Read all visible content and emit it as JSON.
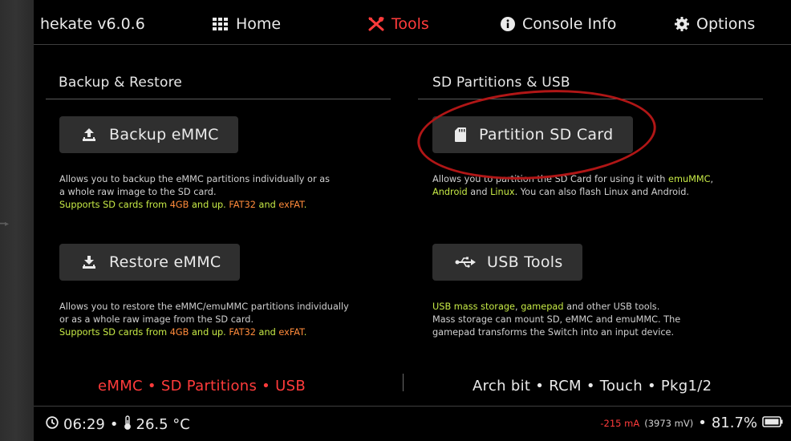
{
  "navbar": {
    "title": "hekate v6.0.6",
    "items": [
      {
        "label": "Home",
        "icon": "grid-icon",
        "active": false
      },
      {
        "label": "Tools",
        "icon": "tools-icon",
        "active": true
      },
      {
        "label": "Console Info",
        "icon": "info-icon",
        "active": false
      },
      {
        "label": "Options",
        "icon": "gear-icon",
        "active": false
      }
    ]
  },
  "backup_restore": {
    "title": "Backup & Restore",
    "backup_button": {
      "label": "Backup eMMC",
      "icon": "upload-icon"
    },
    "backup_desc": {
      "line1": "Allows you to backup the eMMC partitions individually or as",
      "line2": "a whole raw image to the SD card.",
      "line3_a": "Supports SD cards from ",
      "line3_b": "4GB",
      "line3_c": " and up. ",
      "line3_d": "FAT32",
      "line3_e": " and ",
      "line3_f": "exFAT",
      "line3_g": "."
    },
    "restore_button": {
      "label": "Restore eMMC",
      "icon": "download-icon"
    },
    "restore_desc": {
      "line1": "Allows you to restore the eMMC/emuMMC partitions individually",
      "line2": "or as a whole raw image from the SD card.",
      "line3_a": "Supports SD cards from ",
      "line3_b": "4GB",
      "line3_c": " and up. ",
      "line3_d": "FAT32",
      "line3_e": " and ",
      "line3_f": "exFAT",
      "line3_g": "."
    }
  },
  "sd_usb": {
    "title": "SD Partitions & USB",
    "partition_button": {
      "label": "Partition SD Card",
      "icon": "sd-card-icon"
    },
    "partition_desc": {
      "line1_a": "Allows you to partition the SD Card for using it with ",
      "line1_b": "emuMMC",
      "line1_c": ",",
      "line2_a": "Android",
      "line2_b": " and ",
      "line2_c": "Linux",
      "line2_d": ". You can also flash Linux and Android."
    },
    "usb_button": {
      "label": "USB Tools",
      "icon": "usb-icon"
    },
    "usb_desc": {
      "line1_a": "USB mass storage",
      "line1_b": ", ",
      "line1_c": "gamepad",
      "line1_d": " and other USB tools.",
      "line2": "Mass storage can mount SD, eMMC and emuMMC. The",
      "line3": "gamepad transforms the Switch into an input device."
    }
  },
  "bottom_labels": {
    "left": "eMMC • SD Partitions • USB",
    "right": "Arch bit • RCM • Touch • Pkg1/2"
  },
  "status": {
    "time": "06:29",
    "bullet": "•",
    "temperature": "26.5 °C",
    "current": "-215 mA",
    "voltage": "(3973 mV)",
    "battery_percent": "81.7%"
  },
  "colors": {
    "accent_red": "#ff3b3b",
    "highlight_green": "#c7ea46",
    "highlight_orange": "#ff8b3b",
    "annotation_red": "#b01616"
  }
}
